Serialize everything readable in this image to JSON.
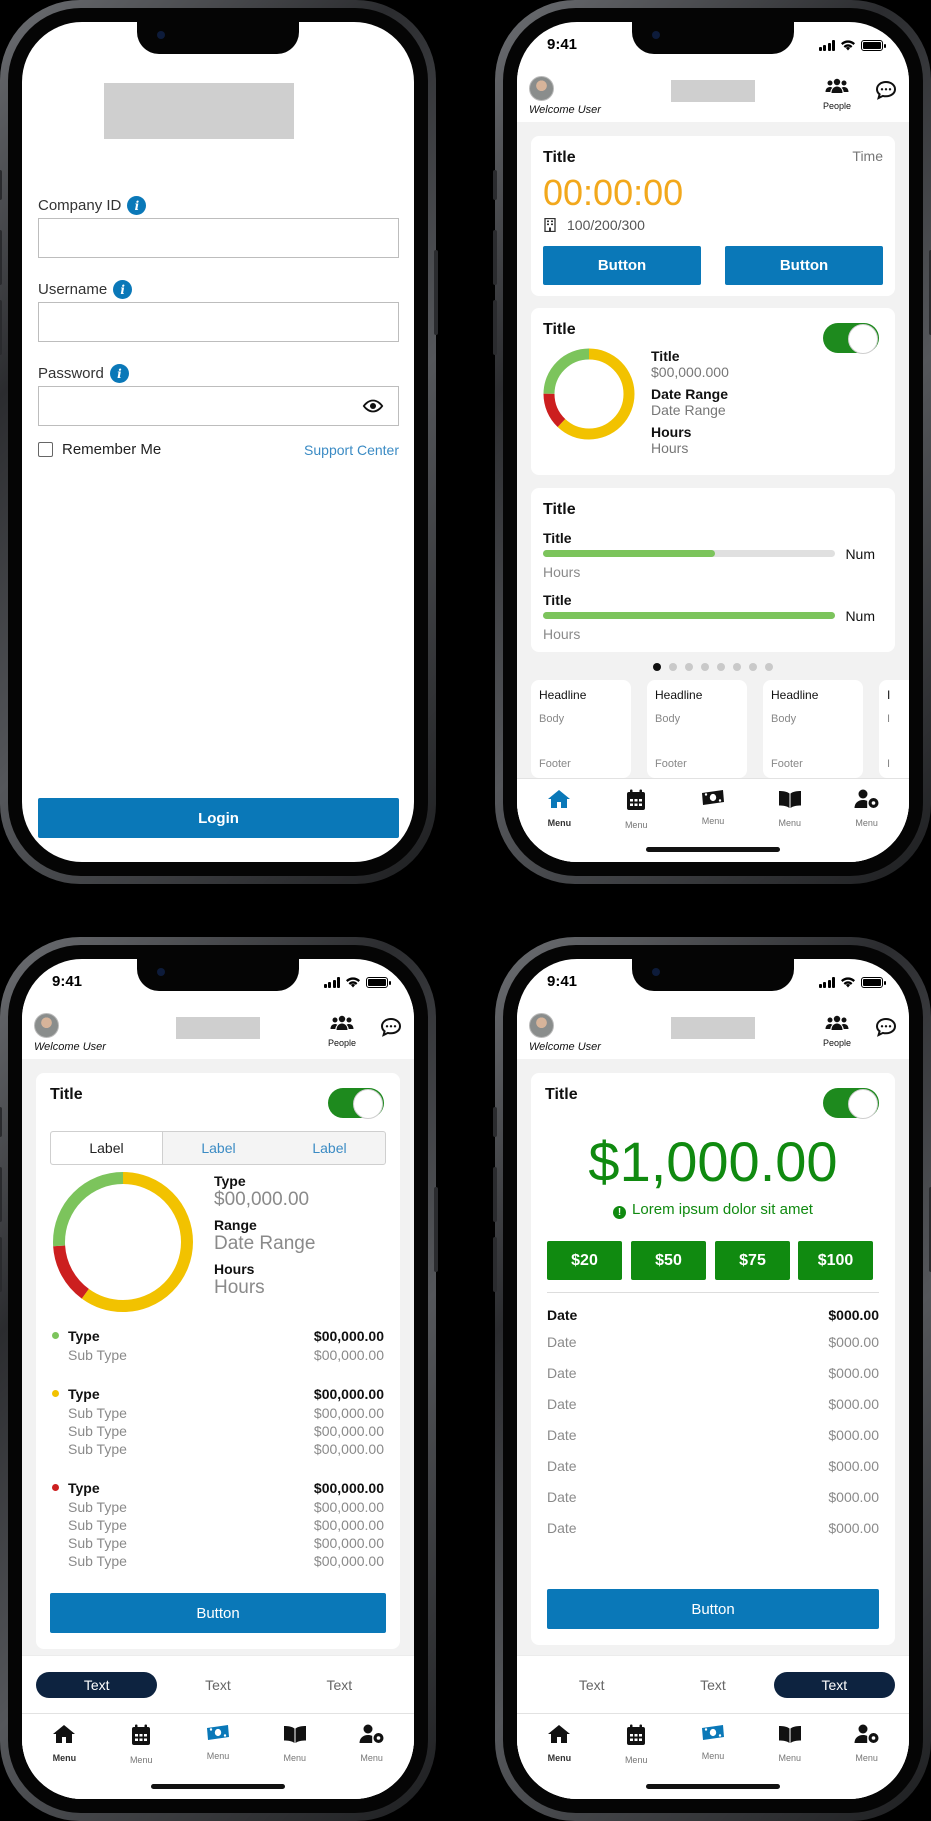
{
  "status": {
    "time": "9:41"
  },
  "header": {
    "welcome": "Welcome User",
    "people_label": "People"
  },
  "login": {
    "company_label": "Company ID",
    "username_label": "Username",
    "password_label": "Password",
    "remember_label": "Remember Me",
    "support_link": "Support Center",
    "login_button": "Login"
  },
  "dashboard": {
    "timer_card": {
      "title": "Title",
      "time_label": "Time",
      "clock": "00:00:00",
      "ids": "100/200/300",
      "button1": "Button",
      "button2": "Button"
    },
    "donut_card": {
      "title": "Title",
      "items": [
        {
          "label": "Title",
          "value": "$00,000.000"
        },
        {
          "label": "Date Range",
          "value": "Date Range"
        },
        {
          "label": "Hours",
          "value": "Hours"
        }
      ],
      "segments": [
        {
          "color": "#f2c200",
          "fraction": 0.62
        },
        {
          "color": "#cc1f1f",
          "fraction": 0.13
        },
        {
          "color": "#7cc45c",
          "fraction": 0.25
        }
      ]
    },
    "progress_card": {
      "title": "Title",
      "rows": [
        {
          "title": "Title",
          "sub": "Hours",
          "num": "Num",
          "progress": 0.59
        },
        {
          "title": "Title",
          "sub": "Hours",
          "num": "Num",
          "progress": 1.0
        }
      ]
    },
    "pager": {
      "count": 8,
      "active": 0
    },
    "mini_cards": [
      {
        "headline": "Headline",
        "body": "Body",
        "footer": "Footer"
      },
      {
        "headline": "Headline",
        "body": "Body",
        "footer": "Footer"
      },
      {
        "headline": "Headline",
        "body": "Body",
        "footer": "Footer"
      },
      {
        "headline": "I",
        "body": "I",
        "footer": "I"
      }
    ]
  },
  "nav": {
    "items": [
      "Menu",
      "Menu",
      "Menu",
      "Menu",
      "Menu"
    ]
  },
  "breakdown": {
    "title": "Title",
    "tabs": [
      "Label",
      "Label",
      "Label"
    ],
    "donut_items": [
      {
        "label": "Type",
        "value": "$00,000.00"
      },
      {
        "label": "Range",
        "value": "Date Range"
      },
      {
        "label": "Hours",
        "value": "Hours"
      }
    ],
    "segments": [
      {
        "color": "#f2c200",
        "fraction": 0.6
      },
      {
        "color": "#cc1f1f",
        "fraction": 0.14
      },
      {
        "color": "#7cc45c",
        "fraction": 0.26
      }
    ],
    "groups": [
      {
        "color": "#7cc45c",
        "type": "Type",
        "amount": "$00,000.00",
        "subs": [
          {
            "label": "Sub Type",
            "amount": "$00,000.00"
          }
        ]
      },
      {
        "color": "#f2c200",
        "type": "Type",
        "amount": "$00,000.00",
        "subs": [
          {
            "label": "Sub Type",
            "amount": "$00,000.00"
          },
          {
            "label": "Sub Type",
            "amount": "$00,000.00"
          },
          {
            "label": "Sub Type",
            "amount": "$00,000.00"
          }
        ]
      },
      {
        "color": "#cc1f1f",
        "type": "Type",
        "amount": "$00,000.00",
        "subs": [
          {
            "label": "Sub Type",
            "amount": "$00,000.00"
          },
          {
            "label": "Sub Type",
            "amount": "$00,000.00"
          },
          {
            "label": "Sub Type",
            "amount": "$00,000.00"
          },
          {
            "label": "Sub Type",
            "amount": "$00,000.00"
          }
        ]
      }
    ],
    "button": "Button",
    "pills": [
      "Text",
      "Text",
      "Text"
    ]
  },
  "payment": {
    "title": "Title",
    "amount": "$1,000.00",
    "note": "Lorem ipsum dolor sit amet",
    "quick_amounts": [
      "$20",
      "$50",
      "$75",
      "$100"
    ],
    "header_row": {
      "label": "Date",
      "amount": "$000.00"
    },
    "rows": [
      {
        "label": "Date",
        "amount": "$000.00"
      },
      {
        "label": "Date",
        "amount": "$000.00"
      },
      {
        "label": "Date",
        "amount": "$000.00"
      },
      {
        "label": "Date",
        "amount": "$000.00"
      },
      {
        "label": "Date",
        "amount": "$000.00"
      },
      {
        "label": "Date",
        "amount": "$000.00"
      },
      {
        "label": "Date",
        "amount": "$000.00"
      }
    ],
    "button": "Button",
    "pills": [
      "Text",
      "Text",
      "Text"
    ]
  },
  "colors": {
    "primary": "#0a78b8",
    "green": "#108a10",
    "toggle": "#1e8a1e",
    "timer": "#f2a81c",
    "pill_active": "#0d2340"
  }
}
